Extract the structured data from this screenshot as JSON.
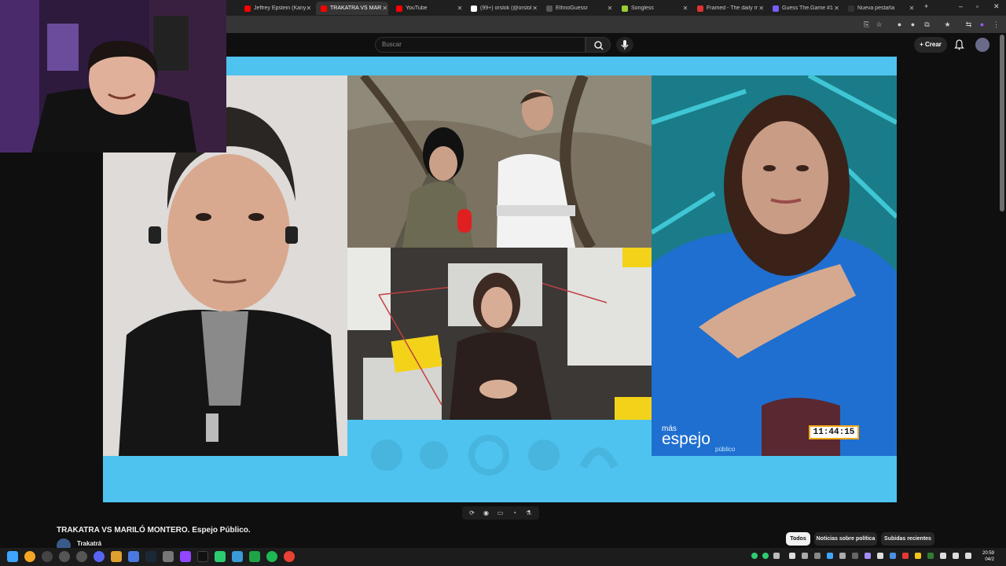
{
  "tabs": [
    {
      "label": "Jeffrey Epstein (Kanye…",
      "fav": "#ff0000",
      "active": false
    },
    {
      "label": "TRAKATRA VS MARILÓ",
      "fav": "#ff0000",
      "active": true
    },
    {
      "label": "YouTube",
      "fav": "#ff0000",
      "active": false
    },
    {
      "label": "(99+) orslok (@orslok…",
      "fav": "#ffffff",
      "active": false
    },
    {
      "label": "EthnoGuessr",
      "fav": "#555555",
      "active": false
    },
    {
      "label": "Songless",
      "fav": "#9acd32",
      "active": false
    },
    {
      "label": "Framed - The daily m…",
      "fav": "#d33",
      "active": false
    },
    {
      "label": "Guess The.Game #136",
      "fav": "#7a5cff",
      "active": false
    },
    {
      "label": "Nueva pestaña",
      "fav": "#333333",
      "active": false
    }
  ],
  "header": {
    "search_placeholder": "Buscar",
    "create_label": "Crear"
  },
  "player": {
    "overlay_clock": "11:44:15",
    "brand_small": "más",
    "brand_large": "espejo",
    "brand_sub": "público"
  },
  "video": {
    "title": "TRAKATRA VS MARILÓ MONTERO. Espejo Público.",
    "channel": "Trakatrá"
  },
  "chips": [
    "Todos",
    "Noticias sobre política",
    "Subidas recientes"
  ],
  "taskbar": {
    "time": "20:59",
    "date": "04/2"
  },
  "colors": {
    "player_bg": "#4ec3ef",
    "clock_border": "#f1a91a"
  }
}
